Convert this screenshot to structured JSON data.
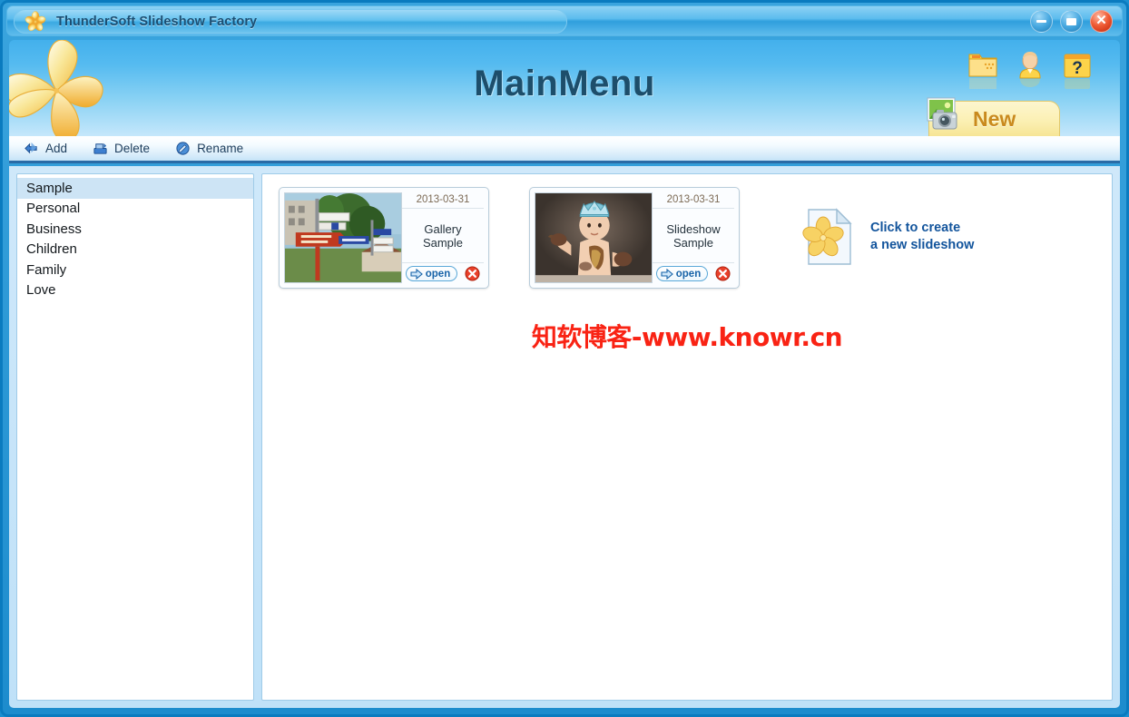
{
  "window": {
    "title": "ThunderSoft Slideshow Factory",
    "controls": {
      "minimize": "minimize-button",
      "maximize": "maximize-button",
      "close": "close-button"
    }
  },
  "header": {
    "title": "MainMenu",
    "icons": [
      {
        "name": "folder-icon",
        "label": "Folder"
      },
      {
        "name": "user-icon",
        "label": "User"
      },
      {
        "name": "help-icon",
        "label": "Help"
      }
    ],
    "new_button": {
      "label": "New",
      "icon": "camera-photo-icon"
    }
  },
  "toolbar": {
    "add_label": "Add",
    "delete_label": "Delete",
    "rename_label": "Rename"
  },
  "sidebar": {
    "items": [
      {
        "label": "Sample",
        "selected": true
      },
      {
        "label": "Personal",
        "selected": false
      },
      {
        "label": "Business",
        "selected": false
      },
      {
        "label": "Children",
        "selected": false
      },
      {
        "label": "Family",
        "selected": false
      },
      {
        "label": "Love",
        "selected": false
      }
    ]
  },
  "content": {
    "cards": [
      {
        "date": "2013-03-31",
        "name_line1": "Gallery",
        "name_line2": "Sample",
        "open_label": "open",
        "thumbnail": "street-signs-photo"
      },
      {
        "date": "2013-03-31",
        "name_line1": "Slideshow",
        "name_line2": "Sample",
        "open_label": "open",
        "thumbnail": "baby-with-crown-photo"
      }
    ],
    "create_new": {
      "line1": "Click to create",
      "line2": "a new slideshow",
      "icon": "new-document-flower-icon"
    },
    "watermark": "知软博客-www.knowr.cn"
  },
  "colors": {
    "frame_blue": "#0a7bbf",
    "header_top": "#43b0ec",
    "header_bottom": "#c5e7fb",
    "title_text": "#1b4f73",
    "accent_link": "#12549c",
    "watermark_red": "#f92314",
    "selection": "#cde4f5",
    "new_button_yellow": "#fbf0b3"
  }
}
